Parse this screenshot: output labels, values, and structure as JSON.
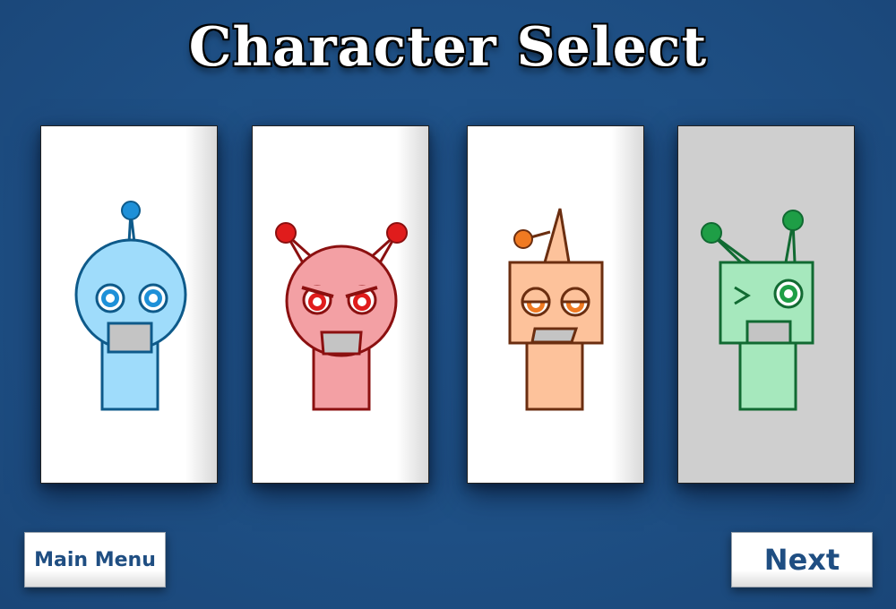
{
  "title": "Character Select",
  "characters": [
    {
      "name": "blue-robot",
      "color": "#9fdcfb",
      "outline": "#0e5a8a",
      "selected": false
    },
    {
      "name": "red-robot",
      "color": "#f3a0a4",
      "outline": "#8b1010",
      "selected": false
    },
    {
      "name": "orange-robot",
      "color": "#fdc29b",
      "outline": "#6b2e10",
      "selected": false
    },
    {
      "name": "green-robot",
      "color": "#a6e8bd",
      "outline": "#116a32",
      "selected": true
    }
  ],
  "buttons": {
    "main_menu": "Main Menu",
    "next": "Next"
  },
  "colors": {
    "background": "#1e4f84",
    "button_text": "#1f4e82",
    "selected_card": "#cfcfcf"
  }
}
